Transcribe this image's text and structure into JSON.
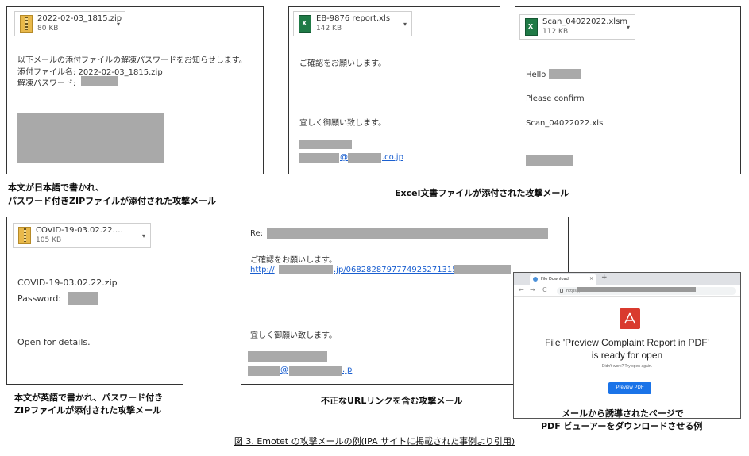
{
  "panel1": {
    "attachment": {
      "name": "2022-02-03_1815.zip",
      "size": "80 KB"
    },
    "lines": [
      "以下メールの添付ファイルの解凍パスワードをお知らせします。",
      "添付ファイル名: 2022-02-03_1815.zip",
      "解凍パスワード:"
    ],
    "caption": [
      "本文が日本語で書かれ、",
      "パスワード付きZIPファイルが添付された攻撃メール"
    ]
  },
  "panel2": {
    "attachment": {
      "name": "EB-9876 report.xls",
      "size": "142 KB"
    },
    "greeting": "ご確認をお願いします。",
    "closing": "宜しく御願い致します。",
    "email_at": "@",
    "email_domain": ".co.jp",
    "caption": "Excel文書ファイルが添付された攻撃メール"
  },
  "panel3": {
    "attachment": {
      "name": "Scan_04022022.xlsm",
      "size": "112 KB"
    },
    "hello": "Hello",
    "confirm": "Please confirm",
    "file": "Scan_04022022.xls"
  },
  "panel4": {
    "attachment": {
      "name": "COVID-19-03.02.22.…",
      "size": "105 KB"
    },
    "line1": "COVID-19-03.02.22.zip",
    "password": "Password:",
    "details": "Open for details.",
    "caption": [
      "本文が英語で書かれ、パスワード付き",
      "ZIPファイルが添付された攻撃メール"
    ]
  },
  "panel5": {
    "re": "Re:",
    "greeting": "ご確認をお願いします。",
    "url_a": "http://",
    "url_b": ".jp/0682828797774925271315",
    "closing": "宜しく御願い致します。",
    "email_at": "@",
    "email_domain": ".jp",
    "caption": "不正なURLリンクを含む攻撃メール"
  },
  "browser": {
    "tab_title": "File Download",
    "tab_close": "×",
    "new_tab": "+",
    "url": "https://",
    "back": "←",
    "forward": "→",
    "reload": "C",
    "title_line1": "File 'Preview Complaint Report in PDF'",
    "title_line2": "is ready for open",
    "sub": "Didn't work? Try open again.",
    "button": "Preview PDF",
    "caption": [
      "メールから誘導されたページで",
      "PDF ビューアーをダウンロードさせる例"
    ]
  },
  "figure_caption": "図 3.  Emotet の攻撃メールの例(IPA サイトに掲載された事例より引用)",
  "icons": {
    "caret": "▾"
  }
}
